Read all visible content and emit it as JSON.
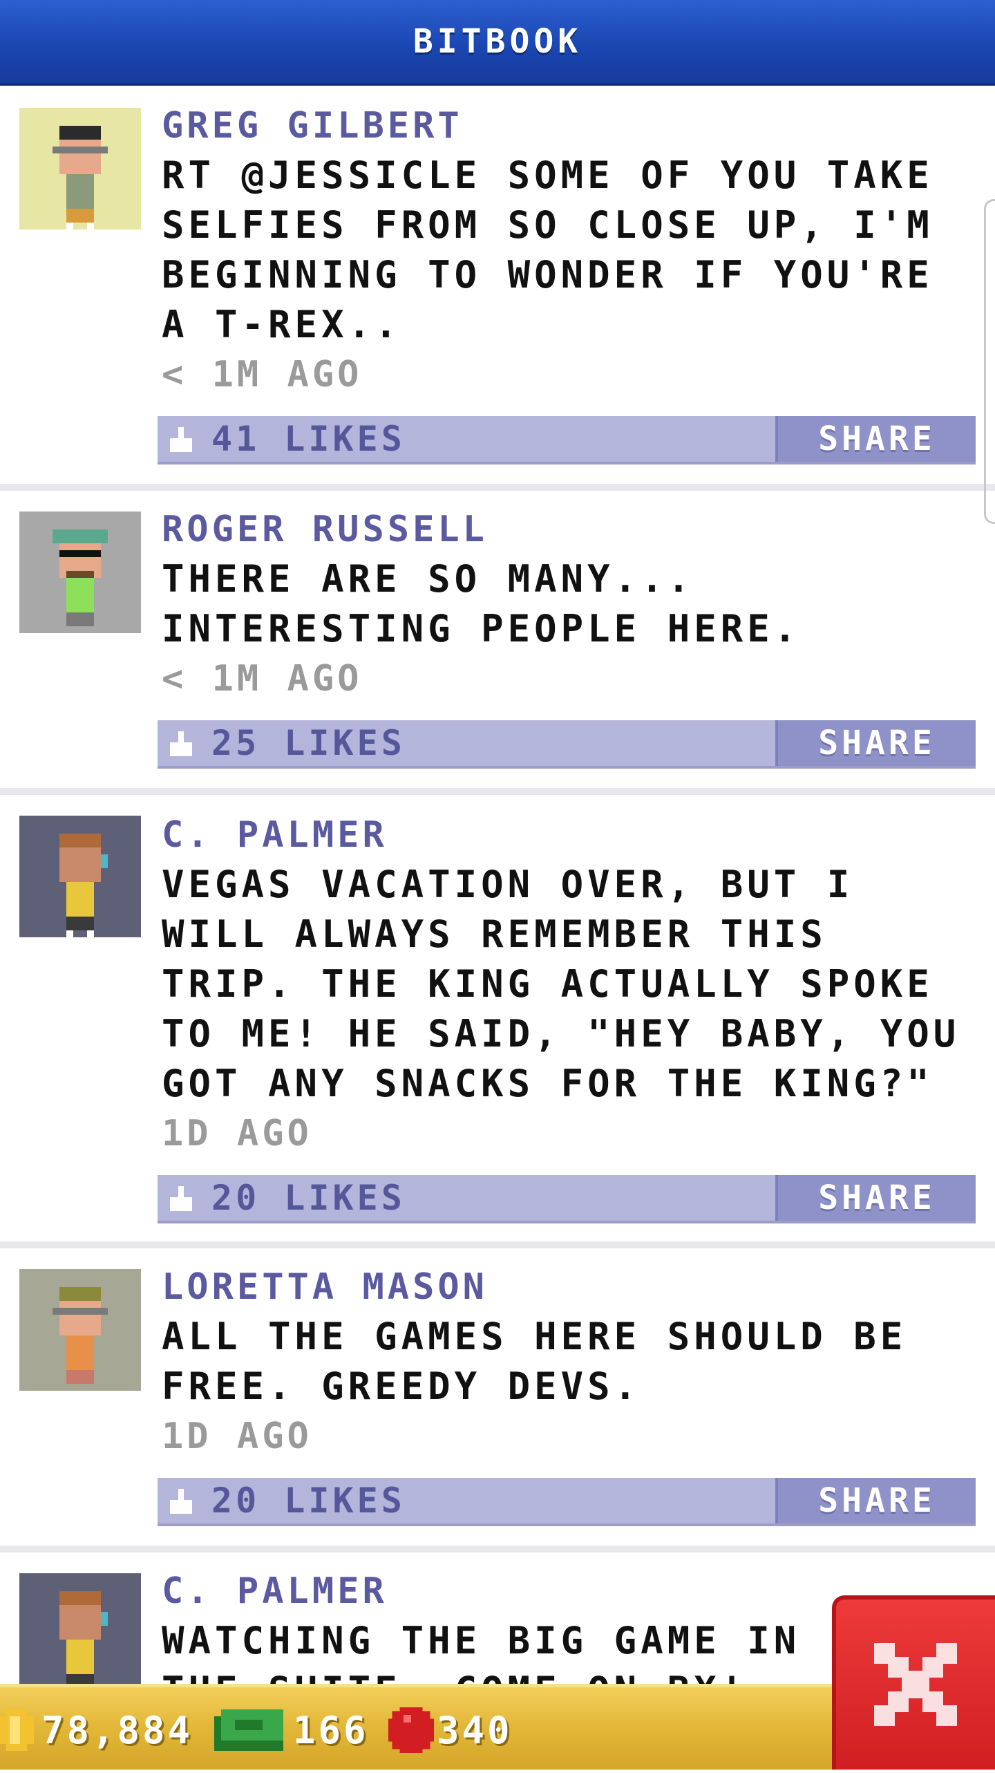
{
  "header": {
    "title": "BITBOOK"
  },
  "posts": [
    {
      "author": "GREG GILBERT",
      "message": "RT @JESSICLE SOME OF YOU TAKE SELFIES FROM SO CLOSE UP, I'M BEGINNING TO WONDER IF YOU'RE A T-REX..",
      "time": "< 1M AGO",
      "likes": "41 LIKES",
      "share": "SHARE",
      "avatar_bg": "#e8e6a4"
    },
    {
      "author": "ROGER RUSSELL",
      "message": "THERE ARE SO MANY... INTERESTING PEOPLE HERE.",
      "time": "< 1M AGO",
      "likes": "25 LIKES",
      "share": "SHARE",
      "avatar_bg": "#a8a8a8"
    },
    {
      "author": "C. PALMER",
      "message": "VEGAS VACATION OVER, BUT I WILL ALWAYS REMEMBER THIS TRIP. THE KING ACTUALLY SPOKE TO ME! HE SAID, \"HEY BABY, YOU GOT ANY SNACKS FOR THE KING?\"",
      "time": "1D AGO",
      "likes": "20 LIKES",
      "share": "SHARE",
      "avatar_bg": "#5e6078"
    },
    {
      "author": "LORETTA MASON",
      "message": "ALL THE GAMES HERE SHOULD BE FREE. GREEDY DEVS.",
      "time": "1D AGO",
      "likes": "20 LIKES",
      "share": "SHARE",
      "avatar_bg": "#a7a795"
    },
    {
      "author": "C. PALMER",
      "message": "WATCHING THE BIG GAME IN THE SUITE. COME ON BX!",
      "avatar_bg": "#5e6078"
    }
  ],
  "footer": {
    "coins": "78,884",
    "bux": "166",
    "points": "340"
  },
  "colors": {
    "header": "#1a45b0",
    "likebar": "#b3b5db",
    "share": "#8f92c8",
    "footer": "#e2b637",
    "close": "#d01e22"
  }
}
